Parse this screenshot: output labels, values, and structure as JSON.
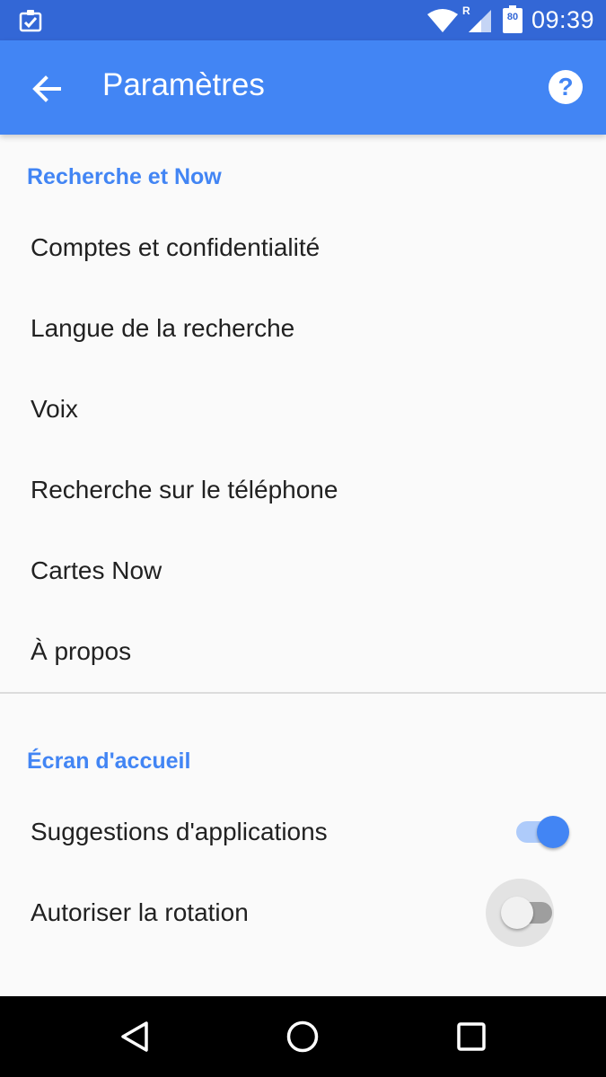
{
  "status_bar": {
    "time": "09:39",
    "roaming_indicator": "R",
    "battery_level": "80",
    "icons": [
      "task-check-icon",
      "wifi-icon",
      "signal-icon",
      "battery-icon"
    ]
  },
  "app_bar": {
    "title": "Paramètres",
    "back_icon": "arrow-back-icon",
    "help_icon": "help-circle-icon"
  },
  "sections": [
    {
      "header": "Recherche et Now",
      "items": [
        {
          "label": "Comptes et confidentialité"
        },
        {
          "label": "Langue de la recherche"
        },
        {
          "label": "Voix"
        },
        {
          "label": "Recherche sur le téléphone"
        },
        {
          "label": "Cartes Now"
        },
        {
          "label": "À propos"
        }
      ]
    },
    {
      "header": "Écran d'accueil",
      "items": [
        {
          "label": "Suggestions d'applications",
          "toggle": true
        },
        {
          "label": "Autoriser la rotation",
          "toggle": false
        }
      ]
    }
  ],
  "nav_bar": {
    "icons": [
      "back-triangle-icon",
      "home-circle-icon",
      "recents-square-icon"
    ]
  },
  "colors": {
    "status_bar": "#3367d6",
    "app_bar": "#4285f4",
    "accent": "#4285f4",
    "background": "#fafafa",
    "nav_bar": "#000000"
  }
}
